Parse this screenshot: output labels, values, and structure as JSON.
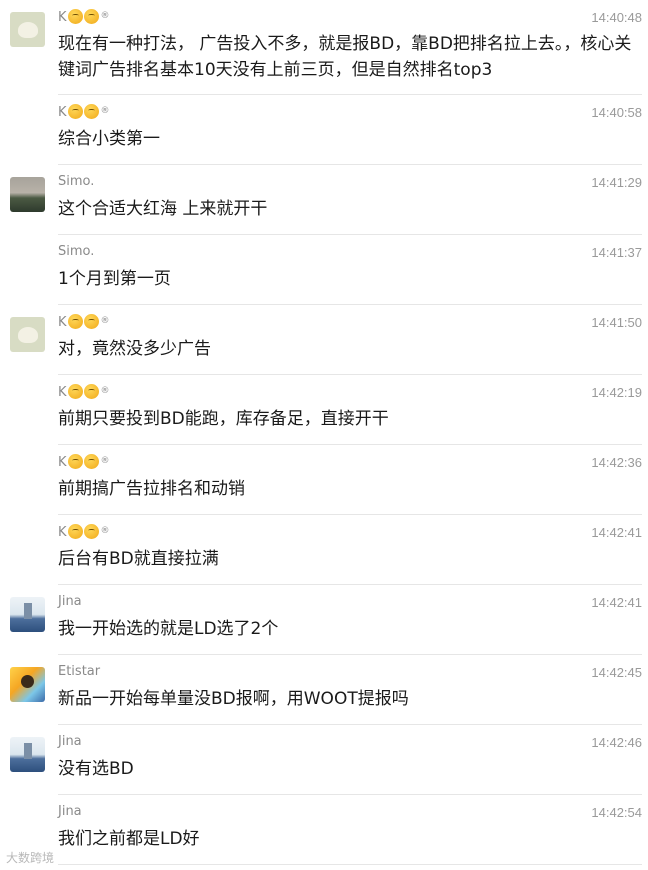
{
  "messages": [
    {
      "sender": "K",
      "emoji_badges": true,
      "time": "14:40:48",
      "text": "现在有一种打法， 广告投入不多，就是报BD，靠BD把排名拉上去。，核心关键词广告排名基本10天没有上前三页，但是自然排名top3",
      "avatar": "cat",
      "show_avatar": true
    },
    {
      "sender": "K",
      "emoji_badges": true,
      "time": "14:40:58",
      "text": "综合小类第一",
      "avatar": "cat",
      "show_avatar": false
    },
    {
      "sender": "Simo.",
      "emoji_badges": false,
      "time": "14:41:29",
      "text": "这个合适大红海 上来就开干",
      "avatar": "sea",
      "show_avatar": true
    },
    {
      "sender": "Simo.",
      "emoji_badges": false,
      "time": "14:41:37",
      "text": "1个月到第一页",
      "avatar": "sea",
      "show_avatar": false
    },
    {
      "sender": "K",
      "emoji_badges": true,
      "time": "14:41:50",
      "text": "对，竟然没多少广告",
      "avatar": "cat",
      "show_avatar": true
    },
    {
      "sender": "K",
      "emoji_badges": true,
      "time": "14:42:19",
      "text": "前期只要投到BD能跑，库存备足，直接开干",
      "avatar": "cat",
      "show_avatar": false
    },
    {
      "sender": "K",
      "emoji_badges": true,
      "time": "14:42:36",
      "text": "前期搞广告拉排名和动销",
      "avatar": "cat",
      "show_avatar": false
    },
    {
      "sender": "K",
      "emoji_badges": true,
      "time": "14:42:41",
      "text": "后台有BD就直接拉满",
      "avatar": "cat",
      "show_avatar": false
    },
    {
      "sender": "Jina",
      "emoji_badges": false,
      "time": "14:42:41",
      "text": "我一开始选的就是LD选了2个",
      "avatar": "jina",
      "show_avatar": true
    },
    {
      "sender": "Etistar",
      "emoji_badges": false,
      "time": "14:42:45",
      "text": "新品一开始每单量没BD报啊，用WOOT提报吗",
      "avatar": "eti",
      "show_avatar": true
    },
    {
      "sender": "Jina",
      "emoji_badges": false,
      "time": "14:42:46",
      "text": "没有选BD",
      "avatar": "jina",
      "show_avatar": true
    },
    {
      "sender": "Jina",
      "emoji_badges": false,
      "time": "14:42:54",
      "text": "我们之前都是LD好",
      "avatar": "jina",
      "show_avatar": false
    }
  ],
  "watermark": "大数跨境"
}
